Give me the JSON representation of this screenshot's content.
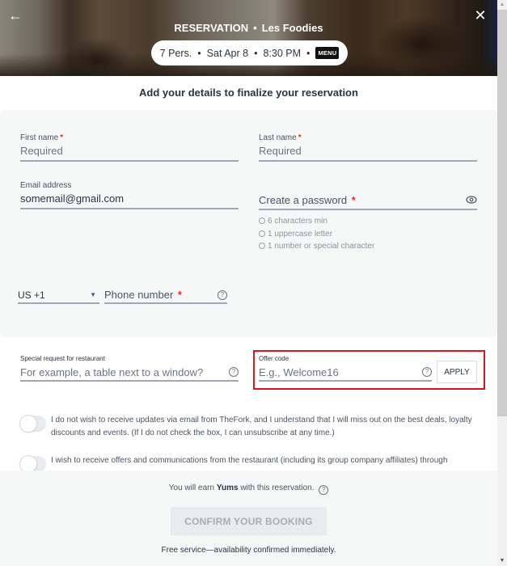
{
  "header": {
    "title_prefix": "RESERVATION",
    "title_separator": "•",
    "restaurant": "Les Foodies",
    "back_icon": "←",
    "close_icon": "✕",
    "summary": {
      "persons": "7 Pers.",
      "date": "Sat Apr 8",
      "time": "8:30 PM",
      "separator": "•",
      "menu_label": "MENU"
    }
  },
  "subtitle": "Add your details to finalize your reservation",
  "form": {
    "first_name": {
      "label": "First name",
      "required_mark": "*",
      "placeholder": "Required",
      "value": ""
    },
    "last_name": {
      "label": "Last name",
      "required_mark": "*",
      "placeholder": "Required",
      "value": ""
    },
    "email": {
      "label": "Email address",
      "value": "somemail@gmail.com"
    },
    "password": {
      "label": "Create a password",
      "required_mark": "*",
      "rules": [
        "6 characters min",
        "1 uppercase letter",
        "1 number or special character"
      ]
    },
    "country_code": {
      "value": "US +1",
      "caret": "▼"
    },
    "phone": {
      "label": "Phone number",
      "required_mark": "*",
      "help": "?"
    },
    "special_request": {
      "label": "Special request for restaurant",
      "placeholder": "For example, a table next to a window?",
      "help": "?"
    },
    "offer_code": {
      "label": "Offer code",
      "placeholder": "E.g., Welcome16",
      "help": "?",
      "apply_label": "APPLY",
      "highlight_color": "#e3111b"
    }
  },
  "consents": [
    {
      "text": "I do not wish to receive updates via email from TheFork, and I understand that I will miss out on the best deals, loyalty discounts and events. (If I do not check the box, I can unsubscribe at any time.)",
      "checked": false
    },
    {
      "text": "I wish to receive offers and communications from the restaurant (including its group company affiliates) through",
      "checked": false
    }
  ],
  "footer": {
    "yums_prefix": "You will earn",
    "yums_bold": "Yums",
    "yums_suffix": "with this reservation.",
    "help": "?",
    "confirm_label": "CONFIRM YOUR BOOKING",
    "free_service": "Free service—availability confirmed immediately."
  },
  "scrollbar": {
    "up": "▲",
    "down": "▼"
  }
}
